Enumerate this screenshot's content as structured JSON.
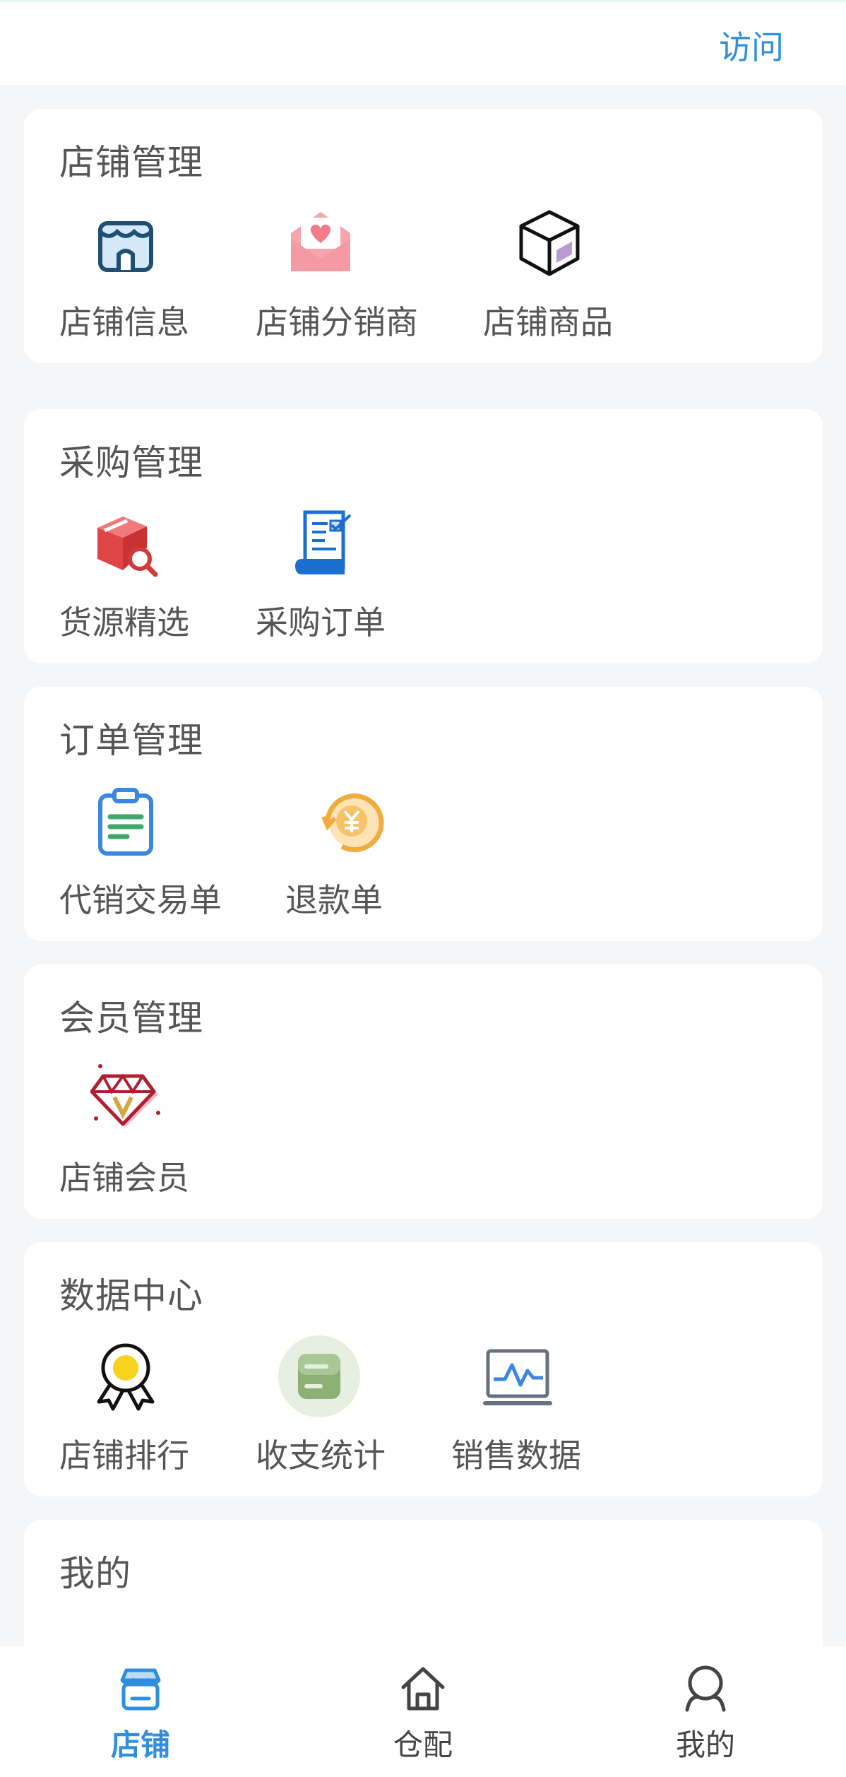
{
  "header": {
    "visit_label": "访问"
  },
  "sections": [
    {
      "title": "店铺管理",
      "items": [
        {
          "label": "店铺信息",
          "icon": "storefront-icon"
        },
        {
          "label": "店铺分销商",
          "icon": "heart-envelope-icon"
        },
        {
          "label": "店铺商品",
          "icon": "box-icon"
        }
      ]
    },
    {
      "title": "采购管理",
      "items": [
        {
          "label": "货源精选",
          "icon": "box-search-icon"
        },
        {
          "label": "采购订单",
          "icon": "document-check-icon"
        }
      ]
    },
    {
      "title": "订单管理",
      "items": [
        {
          "label": "代销交易单",
          "icon": "clipboard-icon"
        },
        {
          "label": "退款单",
          "icon": "yuan-refund-icon"
        }
      ]
    },
    {
      "title": "会员管理",
      "items": [
        {
          "label": "店铺会员",
          "icon": "diamond-vip-icon"
        }
      ]
    },
    {
      "title": "数据中心",
      "items": [
        {
          "label": "店铺排行",
          "icon": "award-ribbon-icon"
        },
        {
          "label": "收支统计",
          "icon": "wallet-icon"
        },
        {
          "label": "销售数据",
          "icon": "chart-monitor-icon"
        }
      ]
    },
    {
      "title": "我的",
      "items": []
    }
  ],
  "tabbar": {
    "tabs": [
      {
        "label": "店铺",
        "icon": "store-tab-icon",
        "active": true
      },
      {
        "label": "仓配",
        "icon": "home-tab-icon",
        "active": false
      },
      {
        "label": "我的",
        "icon": "user-tab-icon",
        "active": false
      }
    ]
  },
  "colors": {
    "accent": "#2f8fde",
    "background": "#f5f6f8",
    "card": "#ffffff"
  }
}
